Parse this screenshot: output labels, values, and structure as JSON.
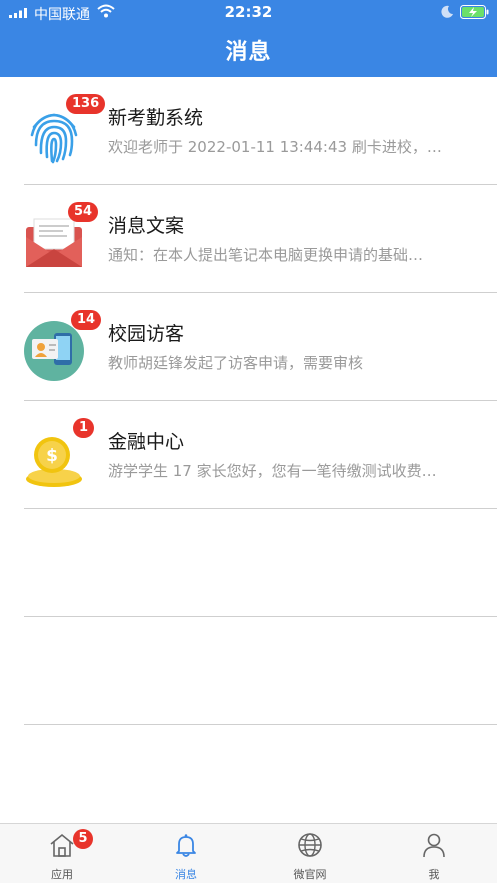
{
  "status_bar": {
    "carrier": "中国联通",
    "time": "22:32"
  },
  "header": {
    "title": "消息"
  },
  "messages": [
    {
      "name": "新考勤系统",
      "preview": "欢迎老师于 2022-01-11 13:44:43 刷卡进校，…",
      "badge": "136",
      "icon": "fingerprint-icon"
    },
    {
      "name": "消息文案",
      "preview": "通知：在本人提出笔记本电脑更换申请的基础…",
      "badge": "54",
      "icon": "envelope-icon"
    },
    {
      "name": "校园访客",
      "preview": "教师胡廷锋发起了访客申请，需要审核",
      "badge": "14",
      "icon": "visitor-id-icon"
    },
    {
      "name": "金融中心",
      "preview": "游学学生 17 家长您好，您有一笔待缴测试收费…",
      "badge": "1",
      "icon": "coin-icon"
    }
  ],
  "tabbar": {
    "tabs": [
      {
        "label": "应用",
        "badge": "5",
        "icon": "home-icon"
      },
      {
        "label": "消息",
        "icon": "bell-icon",
        "active": true
      },
      {
        "label": "微官网",
        "icon": "globe-icon"
      },
      {
        "label": "我",
        "icon": "user-icon"
      }
    ]
  },
  "colors": {
    "header": "#3a86e4",
    "badge": "#e8342b",
    "active_tab": "#3a86e4"
  }
}
